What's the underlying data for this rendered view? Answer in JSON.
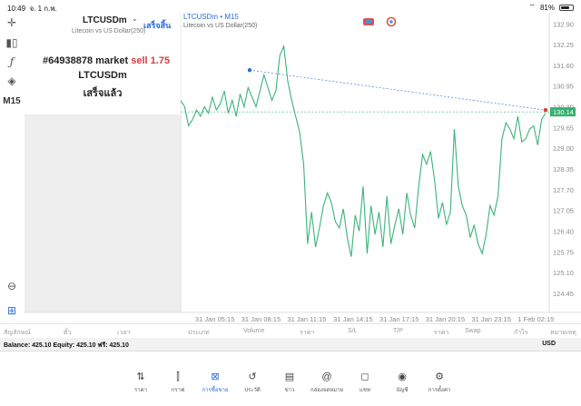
{
  "status_bar": {
    "time": "10:49",
    "date": "จ. 1 ก.พ.",
    "battery": "81%",
    "battery_level": 0.81
  },
  "toolbar": {
    "timeframe": "M15"
  },
  "chart_header": {
    "symbol_tf": "LTCUSDm • M15",
    "description": "Litecoin vs US Dollar(250)"
  },
  "popup": {
    "symbol": "LTCUSDm",
    "badge": "เสร็จสิ้น",
    "description": "Litecoin vs US Dollar(250)",
    "order_line": "#64938878 market",
    "side_price": "sell 1.75",
    "line2": "LTCUSDm",
    "line3": "เสร็จแล้ว"
  },
  "colors": {
    "accent": "#2b6fd6",
    "line": "#3cb37a",
    "sell": "#d83c3c",
    "price_label": "#35b06e"
  },
  "chart_data": {
    "type": "line",
    "ylim": [
      123.85,
      133.25
    ],
    "y_ticks": [
      "132.90",
      "132.25",
      "131.60",
      "130.95",
      "130.30",
      "129.65",
      "129.00",
      "128.35",
      "127.70",
      "127.05",
      "126.40",
      "125.75",
      "125.10",
      "124.45"
    ],
    "y_tick_values": [
      132.9,
      132.25,
      131.6,
      130.95,
      130.3,
      129.65,
      129.0,
      128.35,
      127.7,
      127.05,
      126.4,
      125.75,
      125.1,
      124.45
    ],
    "x_ticks": [
      "31 Jan 05:15",
      "31 Jan 08:15",
      "31 Jan 11:15",
      "31 Jan 14:15",
      "31 Jan 17:15",
      "31 Jan 20:15",
      "31 Jan 23:15",
      "1 Feb 02:15"
    ],
    "last_price": "130.14",
    "last_value": 130.14,
    "series": [
      {
        "values": [
          130.5,
          130.3,
          129.7,
          129.9,
          130.2,
          130.0,
          130.3,
          130.1,
          130.6,
          130.2,
          130.4,
          130.8,
          130.1,
          130.5,
          130.0,
          130.7,
          130.3,
          130.9,
          130.6,
          130.3,
          130.8,
          131.3,
          130.9,
          130.5,
          130.8,
          131.9,
          132.2,
          131.1,
          130.5,
          130.0,
          129.5,
          128.5,
          126.0,
          127.0,
          125.9,
          126.5,
          127.2,
          127.6,
          127.3,
          126.7,
          126.5,
          127.1,
          126.2,
          125.6,
          126.9,
          126.4,
          127.8,
          125.7,
          127.2,
          126.3,
          127.0,
          125.9,
          127.5,
          126.0,
          126.6,
          127.1,
          126.3,
          127.6,
          126.9,
          126.5,
          127.8,
          128.8,
          128.5,
          128.9,
          128.0,
          126.8,
          127.3,
          126.6,
          127.0,
          129.6,
          127.8,
          127.2,
          126.9,
          126.2,
          126.6,
          126.0,
          125.7,
          126.3,
          127.2,
          126.9,
          127.5,
          129.3,
          129.8,
          129.6,
          129.3,
          130.0,
          129.2,
          129.3,
          129.6,
          129.7,
          129.1,
          129.9,
          130.1
        ]
      }
    ]
  }
}
